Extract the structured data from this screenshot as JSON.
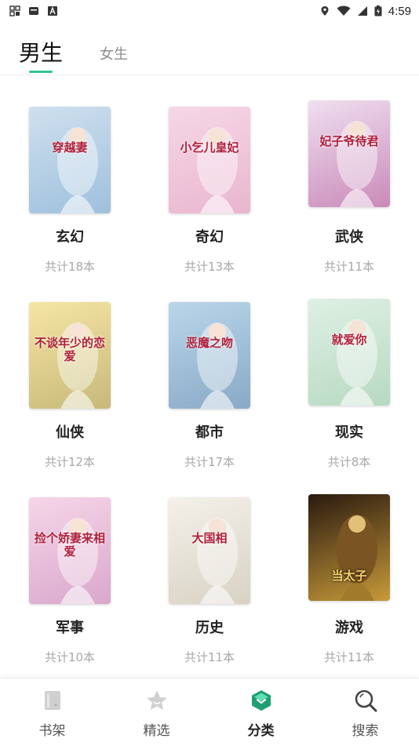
{
  "status_bar": {
    "time": "4:59",
    "icons": [
      "grid-icon",
      "notification-icon",
      "font-icon",
      "location-icon",
      "wifi-icon",
      "signal-icon",
      "battery-icon"
    ]
  },
  "tabs": [
    {
      "label": "男生",
      "active": true
    },
    {
      "label": "女生",
      "active": false
    }
  ],
  "accent_color": "#34c38f",
  "categories": [
    {
      "name": "玄幻",
      "count": "共计18本",
      "cover_title": "穿越妻",
      "cover_colors": [
        "#cfe0ee",
        "#9ec0dd"
      ]
    },
    {
      "name": "奇幻",
      "count": "共计13本",
      "cover_title": "小乞儿皇妃",
      "cover_colors": [
        "#f6d7e6",
        "#e9b6cf"
      ]
    },
    {
      "name": "武侠",
      "count": "共计11本",
      "cover_title": "妃子爷待君",
      "cover_colors": [
        "#f0dff0",
        "#c98ab9"
      ]
    },
    {
      "name": "仙侠",
      "count": "共计12本",
      "cover_title": "不谈年少的恋爱",
      "cover_colors": [
        "#f6e6a6",
        "#c7b979"
      ]
    },
    {
      "name": "都市",
      "count": "共计17本",
      "cover_title": "恶魔之吻",
      "cover_colors": [
        "#b9d6ea",
        "#8aa9c6"
      ]
    },
    {
      "name": "现实",
      "count": "共计8本",
      "cover_title": "就爱你",
      "cover_colors": [
        "#dff0e4",
        "#b7d9c2"
      ]
    },
    {
      "name": "军事",
      "count": "共计10本",
      "cover_title": "捡个娇妻来相爱",
      "cover_colors": [
        "#f6d6e8",
        "#d9a7cc"
      ]
    },
    {
      "name": "历史",
      "count": "共计11本",
      "cover_title": "大国相",
      "cover_colors": [
        "#f4f1ea",
        "#d8d2c4"
      ]
    },
    {
      "name": "游戏",
      "count": "共计11本",
      "cover_title": "当太子",
      "cover_colors": [
        "#2a1a0f",
        "#c79a3a"
      ]
    }
  ],
  "bottom_nav": [
    {
      "label": "书架",
      "icon": "bookshelf-icon",
      "active": false
    },
    {
      "label": "精选",
      "icon": "star-icon",
      "active": false
    },
    {
      "label": "分类",
      "icon": "category-icon",
      "active": true
    },
    {
      "label": "搜索",
      "icon": "search-icon",
      "active": false
    }
  ]
}
